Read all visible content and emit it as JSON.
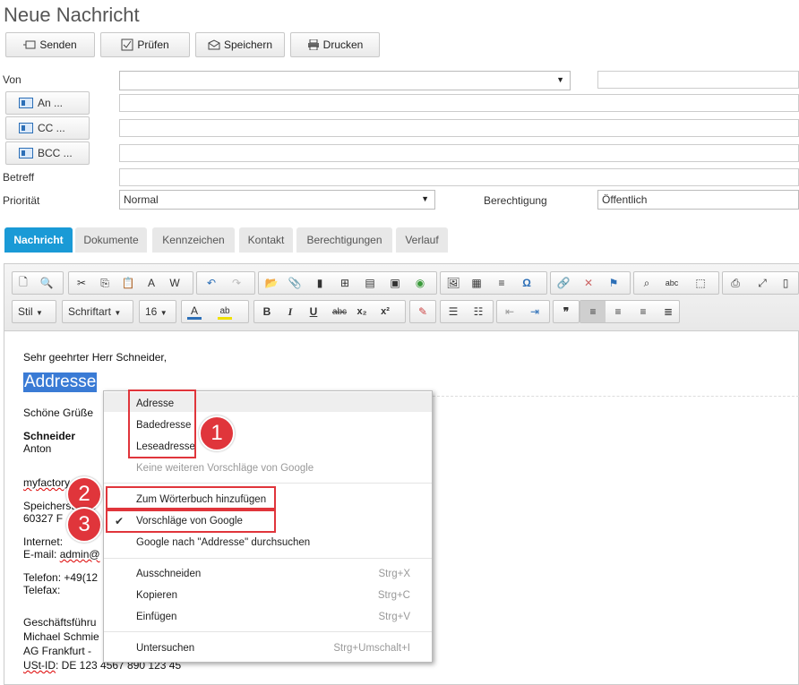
{
  "window": {
    "title": "Neue Nachricht"
  },
  "toolbar": {
    "send": "Senden",
    "check": "Prüfen",
    "save": "Speichern",
    "print": "Drucken"
  },
  "form": {
    "from_label": "Von",
    "to_button": "An ...",
    "cc_button": "CC ...",
    "bcc_button": "BCC ...",
    "subject_label": "Betreff",
    "priority_label": "Priorität",
    "priority_value": "Normal",
    "permission_label": "Berechtigung",
    "permission_value": "Öffentlich"
  },
  "tabs": [
    "Nachricht",
    "Dokumente",
    "Kennzeichen",
    "Kontakt",
    "Berechtigungen",
    "Verlauf"
  ],
  "editor": {
    "style_combo": "Stil",
    "font_combo": "Schriftart",
    "size_combo": "16",
    "format_labels": {
      "bold": "B",
      "italic": "I",
      "underline": "U",
      "strike": "abc",
      "sub": "x₂",
      "sup": "x²",
      "quote": "❞"
    }
  },
  "content": {
    "greeting": "Sehr geehrter Herr Schneider,",
    "selected_word": "Addresse",
    "regards": "Schöne Grüße",
    "name_last": "Schneider",
    "name_first": "Anton",
    "company": "myfactory",
    "street": "Speicherstraße",
    "city": "60327 F",
    "internet": "Internet:",
    "email_label": "E-mail:",
    "email_value": "admin@",
    "phone": "Telefon: +49(12",
    "fax": "Telefax:",
    "ceo_label": "Geschäftsführu",
    "ceo_name": "Michael Schmie",
    "court": "AG Frankfurt -",
    "vat_id_label": "USt-ID",
    "vat_id_value": ": DE 123 4567 890 123 45"
  },
  "context_menu": {
    "suggestions": [
      "Adresse",
      "Badedresse",
      "Leseadresse"
    ],
    "no_more": "Keine weiteren Vorschläge von Google",
    "add_dict": "Zum Wörterbuch hinzufügen",
    "google_suggest": "Vorschläge von Google",
    "google_search": "Google nach \"Addresse\" durchsuchen",
    "cut": "Ausschneiden",
    "cut_sc": "Strg+X",
    "copy": "Kopieren",
    "copy_sc": "Strg+C",
    "paste": "Einfügen",
    "paste_sc": "Strg+V",
    "inspect": "Untersuchen",
    "inspect_sc": "Strg+Umschalt+I"
  },
  "badges": [
    "1",
    "2",
    "3"
  ],
  "colors": {
    "accent": "#1a9ad6",
    "annotation_red": "#e0353b",
    "selection": "#3a7bd5"
  }
}
